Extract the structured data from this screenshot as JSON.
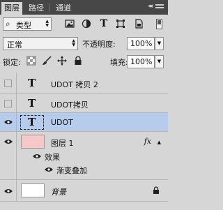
{
  "tabs": {
    "layers": "图层",
    "paths": "路径",
    "channels": "通道",
    "collapse_glyph": "◂◂"
  },
  "filter": {
    "kind_label": "类型"
  },
  "blend": {
    "mode": "正常",
    "opacity_label": "不透明度:",
    "opacity_value": "100%"
  },
  "lock": {
    "label": "锁定:",
    "fill_label": "填充:",
    "fill_value": "100%"
  },
  "layers": [
    {
      "name": "UDOT 拷贝 2",
      "visible": false,
      "type": "text"
    },
    {
      "name": "UDOT拷贝",
      "visible": false,
      "type": "text"
    },
    {
      "name": "UDOT",
      "visible": true,
      "type": "text",
      "selected": true
    },
    {
      "name": "图层 1",
      "visible": true,
      "type": "pixel",
      "thumb_color": "#f8c8c8",
      "fx": "fx"
    },
    {
      "name": "背景",
      "visible": true,
      "type": "background",
      "thumb_color": "#ffffff",
      "locked": true
    }
  ],
  "effects": {
    "label": "效果",
    "items": [
      "渐变叠加"
    ]
  },
  "colors": {
    "tab_bar": "#474747",
    "panel_bg": "#d6d6d6",
    "selection": "#b7cbec"
  }
}
